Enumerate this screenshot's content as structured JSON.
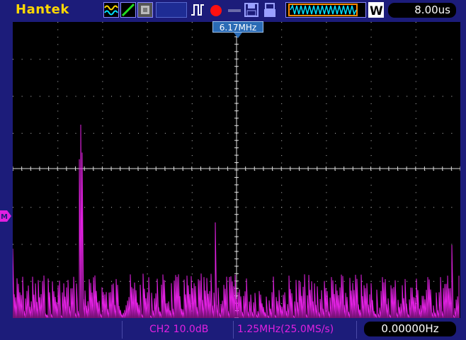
{
  "header": {
    "brand": "Hantek",
    "timebase": "8.00us"
  },
  "trigger": {
    "marker_label": "6.17MHz"
  },
  "channel_marker": "M",
  "footer": {
    "channel_scale": "CH2 10.0dB",
    "sample_info": "1.25MHz(25.0MS/s)",
    "frequency": "0.00000Hz"
  },
  "colors": {
    "background": "#1c1c7a",
    "brand": "#ffd800",
    "trace": "#e020e0",
    "grid": "#c8c8c8",
    "marker": "#2a6bb5"
  },
  "icons": [
    "math-wave-icon",
    "cursor-line-icon",
    "ref-icon",
    "blank-icon",
    "pulse-trigger-icon",
    "record-dot-icon",
    "arrow-icon",
    "save-icon",
    "usb-icon",
    "waveform-window-icon",
    "w-mode-icon"
  ]
}
